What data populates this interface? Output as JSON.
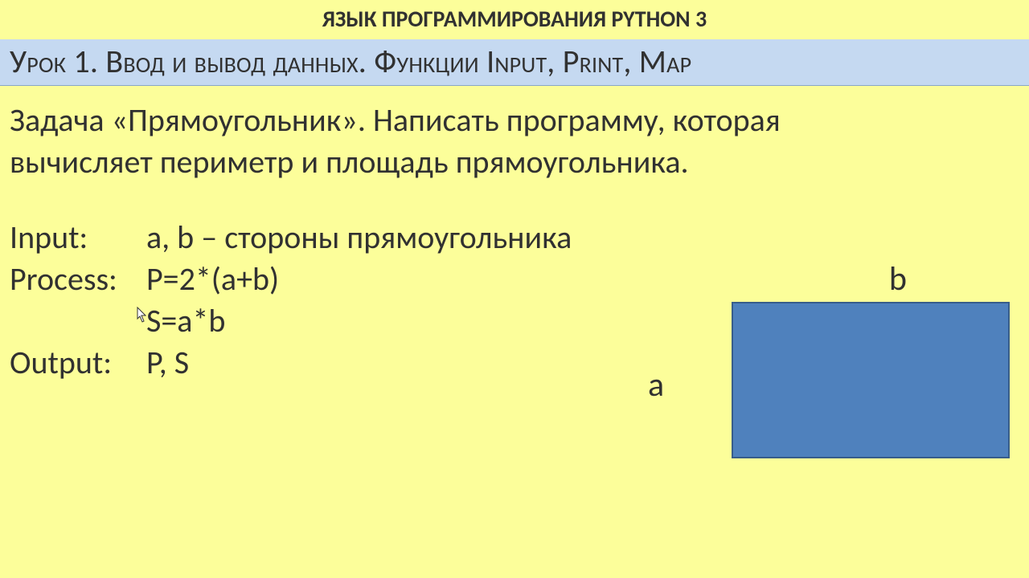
{
  "header": {
    "course": "ЯЗЫК ПРОГРАММИРОВАНИЯ PYTHON 3",
    "lesson": "Урок 1. Ввод и вывод данных. Функции Input, Print, Map"
  },
  "task": {
    "line1": "Задача «Прямоугольник». Написать программу, которая",
    "line2": "вычисляет периметр и площадь прямоугольника."
  },
  "spec": {
    "input_label": "Input:",
    "input_value": "a, b – стороны прямоугольника",
    "process_label": "Process:",
    "process_value": "P=2*(a+b)",
    "process_value2": "S=a*b",
    "output_label": "Output:",
    "output_value": "P, S"
  },
  "diagram": {
    "side_a": "a",
    "side_b": "b"
  }
}
